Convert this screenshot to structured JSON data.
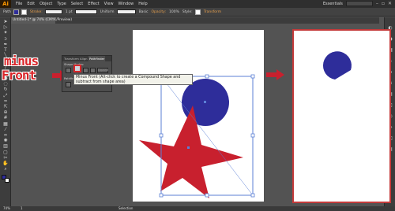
{
  "app": {
    "logo": "Ai",
    "menus": [
      "File",
      "Edit",
      "Object",
      "Type",
      "Select",
      "Effect",
      "View",
      "Window",
      "Help"
    ],
    "workspace": "Essentials",
    "window_controls": [
      "–",
      "▫",
      "✕"
    ]
  },
  "control_bar": {
    "selection": "Path",
    "stroke_label": "Stroke:",
    "stroke_weight": "1 pt",
    "uniform": "Uniform",
    "basic": "Basic",
    "opacity_label": "Opacity:",
    "opacity_value": "100%",
    "style_label": "Style:",
    "transform_label": "Transform"
  },
  "document": {
    "tab_title": "Untitled-1* @ 74% (CMYK/Preview)"
  },
  "pathfinder": {
    "tabs": [
      "Transform",
      "Align",
      "Pathfinder"
    ],
    "shape_modes_label": "Shape Modes:",
    "pathfinders_label": "Pathfinders:",
    "expand_label": "Expand",
    "tooltip": "Minus Front (Alt-click to create a Compound Shape and subtract from shape area)"
  },
  "annotation": {
    "line1": "minus",
    "line2": "Front"
  },
  "status": {
    "zoom": "74%",
    "page": "1",
    "mode": "Selection"
  },
  "colors": {
    "circle": "#2e2d9a",
    "star": "#c8202e",
    "accent_red": "#d9262a",
    "selection_blue": "#5b7fd6"
  },
  "icons": {
    "tools": [
      "selection-tool-icon",
      "direct-selection-tool-icon",
      "magic-wand-tool-icon",
      "lasso-tool-icon",
      "pen-tool-icon",
      "type-tool-icon",
      "line-tool-icon",
      "rectangle-tool-icon",
      "paintbrush-tool-icon",
      "pencil-tool-icon",
      "blob-brush-tool-icon",
      "eraser-tool-icon",
      "rotate-tool-icon",
      "scale-tool-icon",
      "warp-tool-icon",
      "free-transform-tool-icon",
      "shape-builder-tool-icon",
      "mesh-tool-icon",
      "gradient-tool-icon",
      "eyedropper-tool-icon",
      "blend-tool-icon",
      "symbol-sprayer-tool-icon",
      "graph-tool-icon",
      "artboard-tool-icon",
      "slice-tool-icon",
      "hand-tool-icon",
      "zoom-tool-icon"
    ],
    "dock": [
      "color-panel-icon",
      "color-guide-icon",
      "swatches-icon",
      "brushes-icon",
      "symbols-icon",
      "stroke-panel-icon",
      "gradient-panel-icon",
      "transparency-icon",
      "appearance-icon",
      "graphic-styles-icon",
      "layers-icon",
      "artboards-icon"
    ]
  }
}
